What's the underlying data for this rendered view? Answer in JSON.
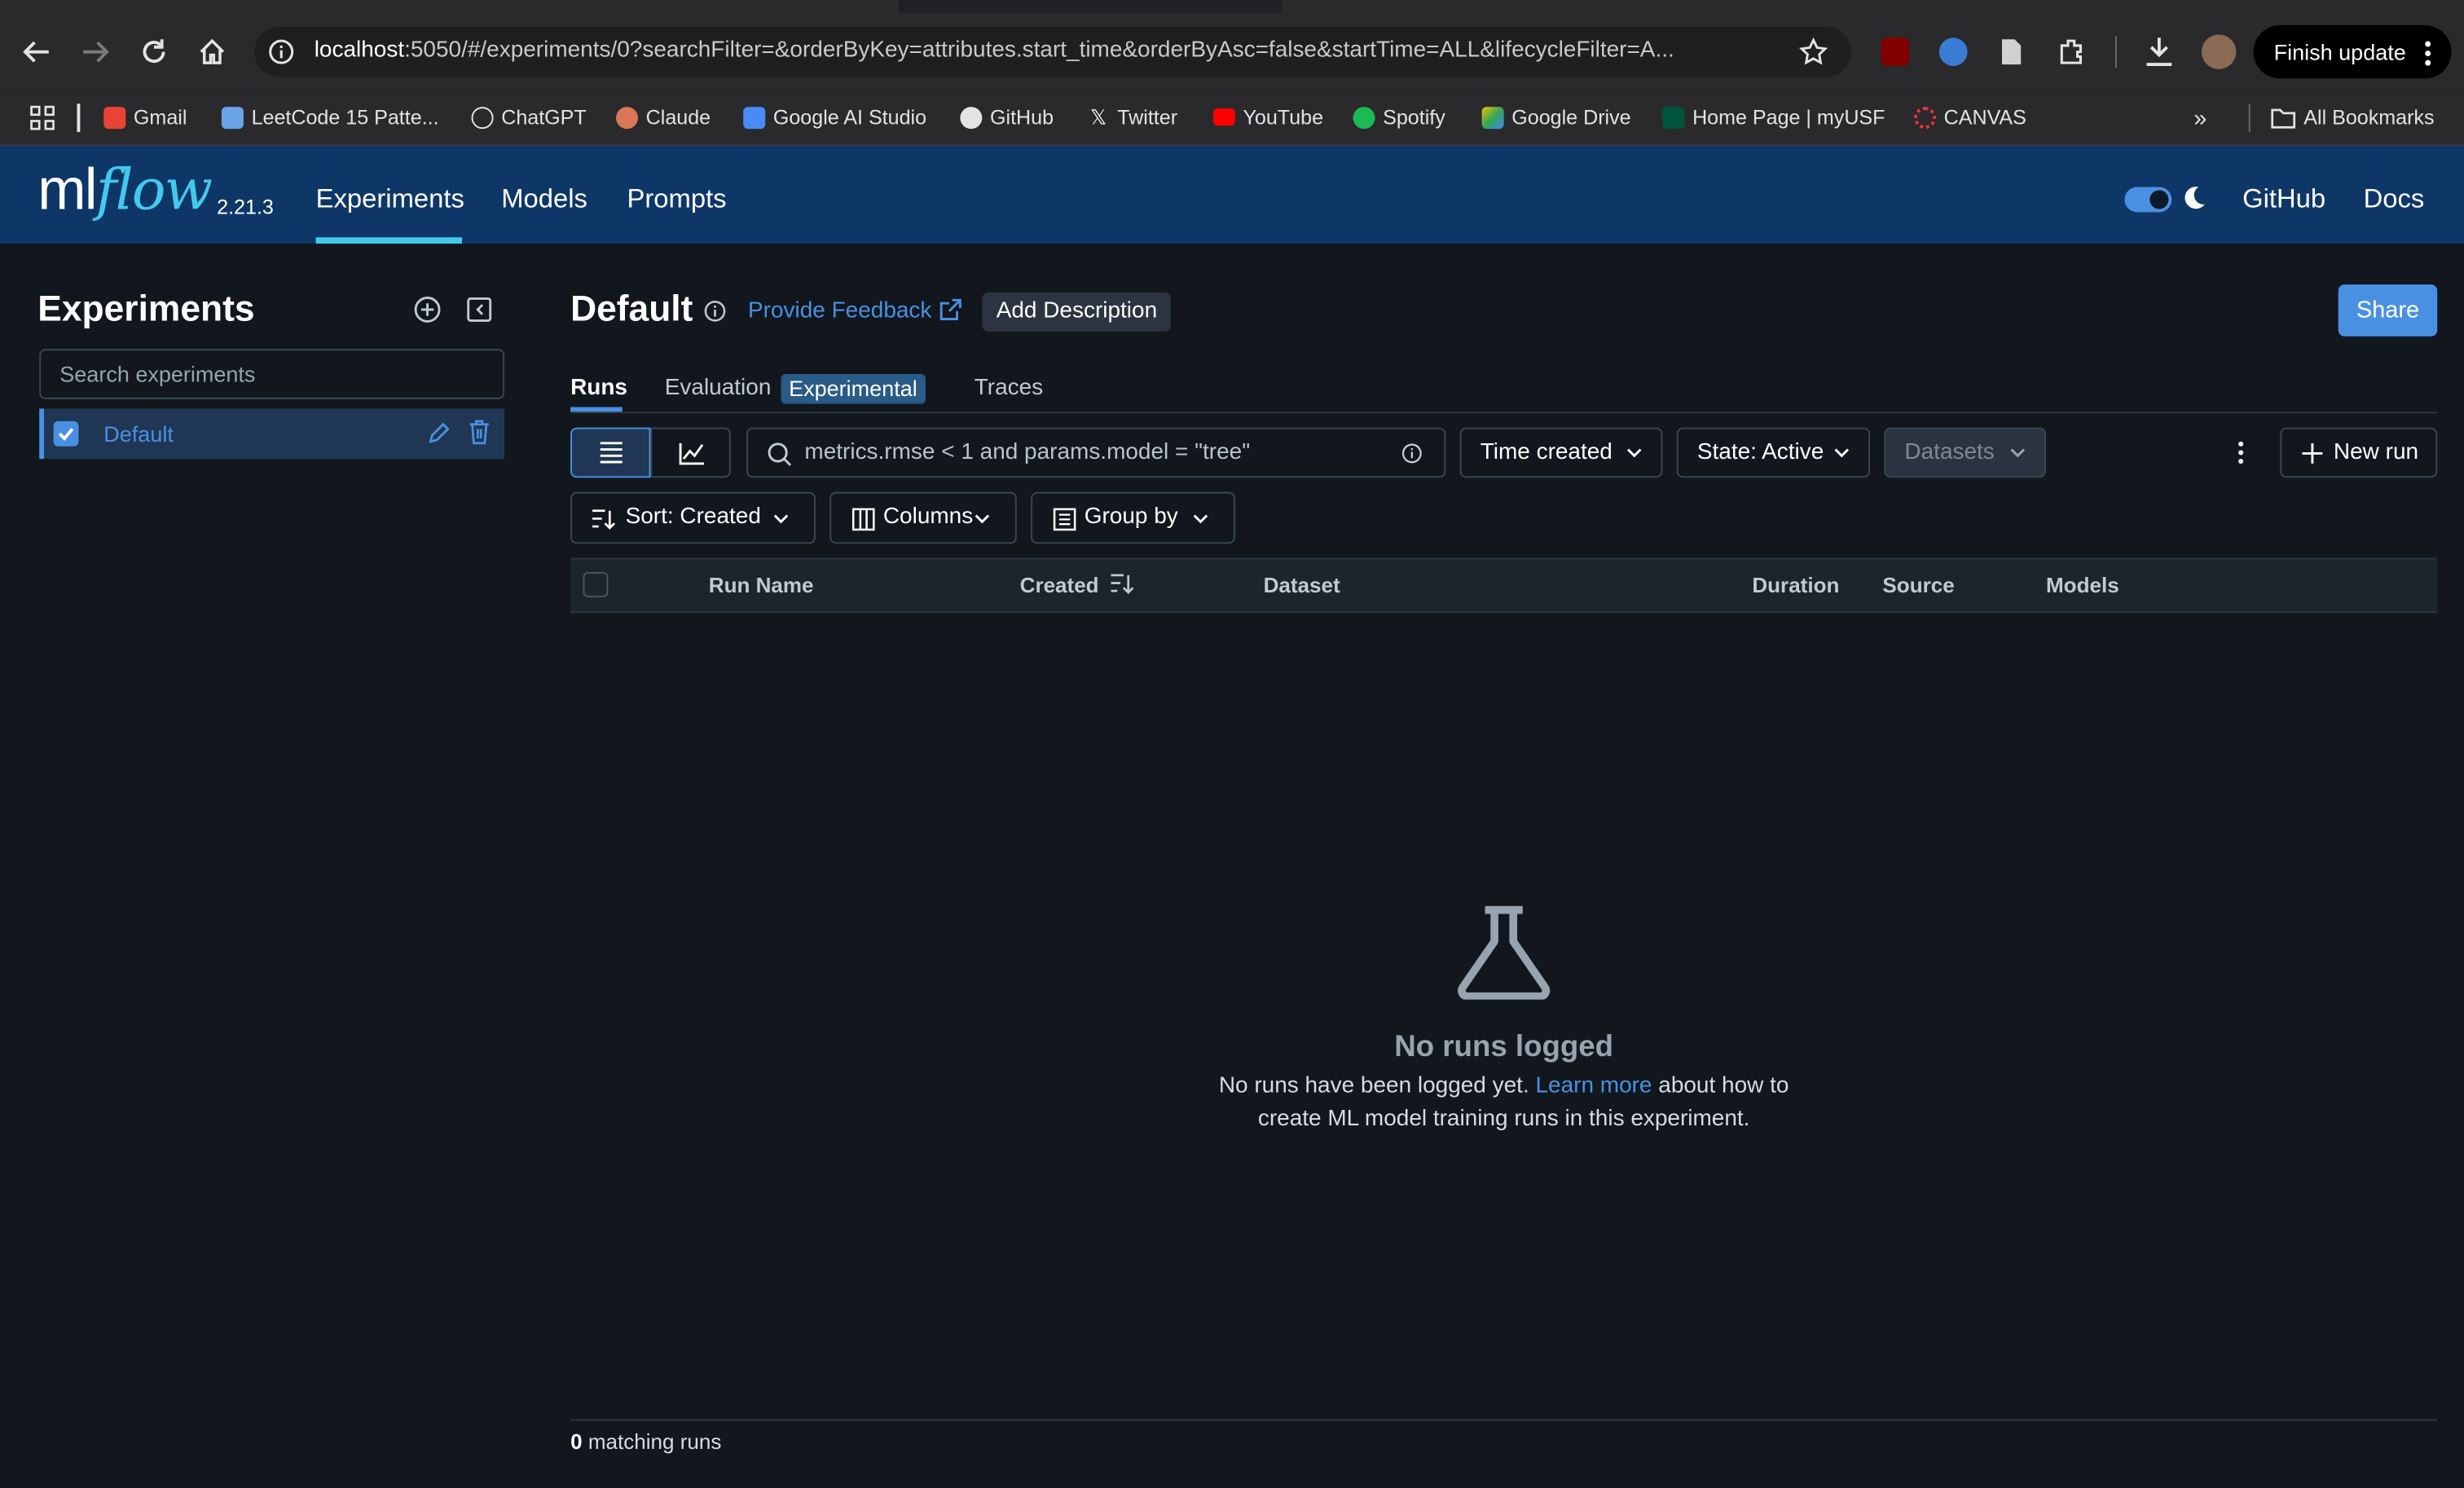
{
  "browser": {
    "url_host": "localhost",
    "url_rest": ":5050/#/experiments/0?searchFilter=&orderByKey=attributes.start_time&orderByAsc=false&startTime=ALL&lifecycleFilter=A...",
    "finish_update": "Finish update",
    "bookmarks": [
      "Gmail",
      "LeetCode 15 Patte...",
      "ChatGPT",
      "Claude",
      "Google AI Studio",
      "GitHub",
      "Twitter",
      "YouTube",
      "Spotify",
      "Google Drive",
      "Home Page | myUSF",
      "CANVAS"
    ],
    "all_bookmarks": "All Bookmarks"
  },
  "header": {
    "logo_ml": "ml",
    "logo_flow": "flow",
    "version": "2.21.3",
    "nav": [
      "Experiments",
      "Models",
      "Prompts"
    ],
    "github": "GitHub",
    "docs": "Docs"
  },
  "sidebar": {
    "title": "Experiments",
    "search_placeholder": "Search experiments",
    "items": [
      {
        "label": "Default",
        "checked": true
      }
    ]
  },
  "main": {
    "title": "Default",
    "feedback": "Provide Feedback",
    "add_description": "Add Description",
    "share": "Share",
    "tabs": [
      "Runs",
      "Evaluation",
      "Traces"
    ],
    "badge": "Experimental",
    "search_placeholder": "metrics.rmse < 1 and params.model = \"tree\"",
    "time_created": "Time created",
    "state": "State: Active",
    "datasets": "Datasets",
    "new_run": "New run",
    "sort": "Sort: Created",
    "columns": "Columns",
    "group_by": "Group by",
    "table_headers": [
      "Run Name",
      "Created",
      "Dataset",
      "Duration",
      "Source",
      "Models"
    ],
    "empty_title": "No runs logged",
    "empty_line1_pre": "No runs have been logged yet.",
    "empty_link": "Learn more",
    "empty_line1_post": "about how to",
    "empty_line2": "create ML model training runs in this experiment.",
    "match_count": "0",
    "match_label": "matching runs"
  },
  "colors": {
    "background": "#11171d",
    "header": "#0e3768",
    "accent": "#4a90e2",
    "logo_accent": "#43c9ed"
  }
}
